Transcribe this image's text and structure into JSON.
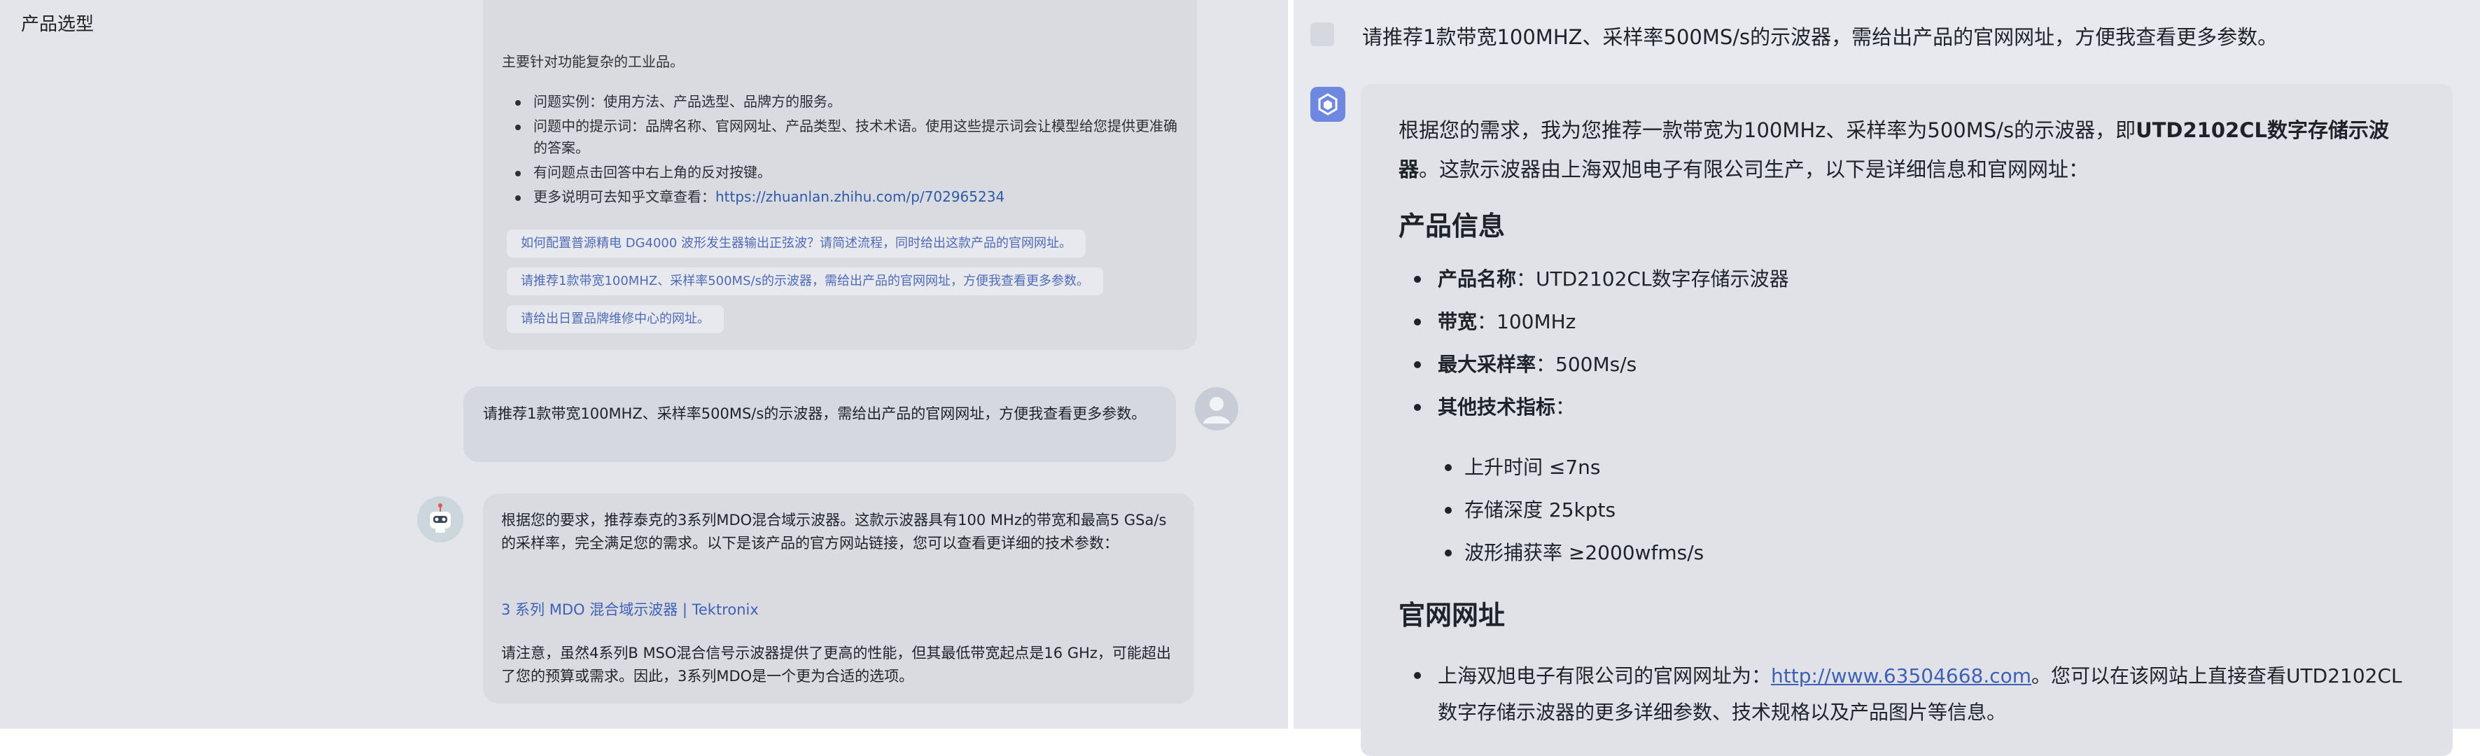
{
  "left": {
    "page_title": "产品选型",
    "intro_tail": "主要针对功能复杂的工业品。",
    "intro_items": [
      "问题实例：使用方法、产品选型、品牌方的服务。",
      "问题中的提示词：品牌名称、官网网址、产品类型、技术术语。使用这些提示词会让模型给您提供更准确的答案。",
      "有问题点击回答中右上角的反对按键。"
    ],
    "more_prefix": "更多说明可去知乎文章查看：",
    "more_link": "https://zhuanlan.zhihu.com/p/702965234",
    "suggestions": [
      "如何配置普源精电 DG4000 波形发生器输出正弦波？请简述流程，同时给出这款产品的官网网址。",
      "请推荐1款带宽100MHZ、采样率500MS/s的示波器，需给出产品的官网网址，方便我查看更多参数。",
      "请给出日置品牌维修中心的网址。"
    ],
    "user_message": "请推荐1款带宽100MHZ、采样率500MS/s的示波器，需给出产品的官网网址，方便我查看更多参数。",
    "bot_para1": "根据您的要求，推荐泰克的3系列MDO混合域示波器。这款示波器具有100 MHz的带宽和最高5 GSa/s的采样率，完全满足您的需求。以下是该产品的官方网站链接，您可以查看更详细的技术参数：",
    "bot_link": "3 系列 MDO 混合域示波器 | Tektronix",
    "bot_para3": "请注意，虽然4系列B MSO混合信号示波器提供了更高的性能，但其最低带宽起点是16 GHz，可能超出了您的预算或需求。因此，3系列MDO是一个更为合适的选项。"
  },
  "right": {
    "question": "请推荐1款带宽100MHZ、采样率500MS/s的示波器，需给出产品的官网网址，方便我查看更多参数。",
    "intro_before": "根据您的需求，我为您推荐一款带宽为100MHz、采样率为500MS/s的示波器，即",
    "intro_bold": "UTD2102CL数字存储示波器",
    "intro_after": "。这款示波器由上海双旭电子有限公司生产，以下是详细信息和官网网址：",
    "section1_title": "产品信息",
    "specs": [
      {
        "label": "产品名称",
        "value": "：UTD2102CL数字存储示波器"
      },
      {
        "label": "带宽",
        "value": "：100MHz"
      },
      {
        "label": "最大采样率",
        "value": "：500Ms/s"
      },
      {
        "label": "其他技术指标",
        "value": "："
      }
    ],
    "sub_specs": [
      "上升时间 ≤7ns",
      "存储深度 25kpts",
      "波形捕获率 ≥2000wfms/s"
    ],
    "section2_title": "官网网址",
    "site_prefix": "上海双旭电子有限公司的官网网址为：",
    "site_link": "http://www.63504668.com",
    "site_suffix": "。您可以在该网站上直接查看UTD2102CL数字存储示波器的更多详细参数、技术规格以及产品图片等信息。"
  },
  "colors": {
    "link": "#3e61b5",
    "bot_logo": "#6e88e0"
  }
}
